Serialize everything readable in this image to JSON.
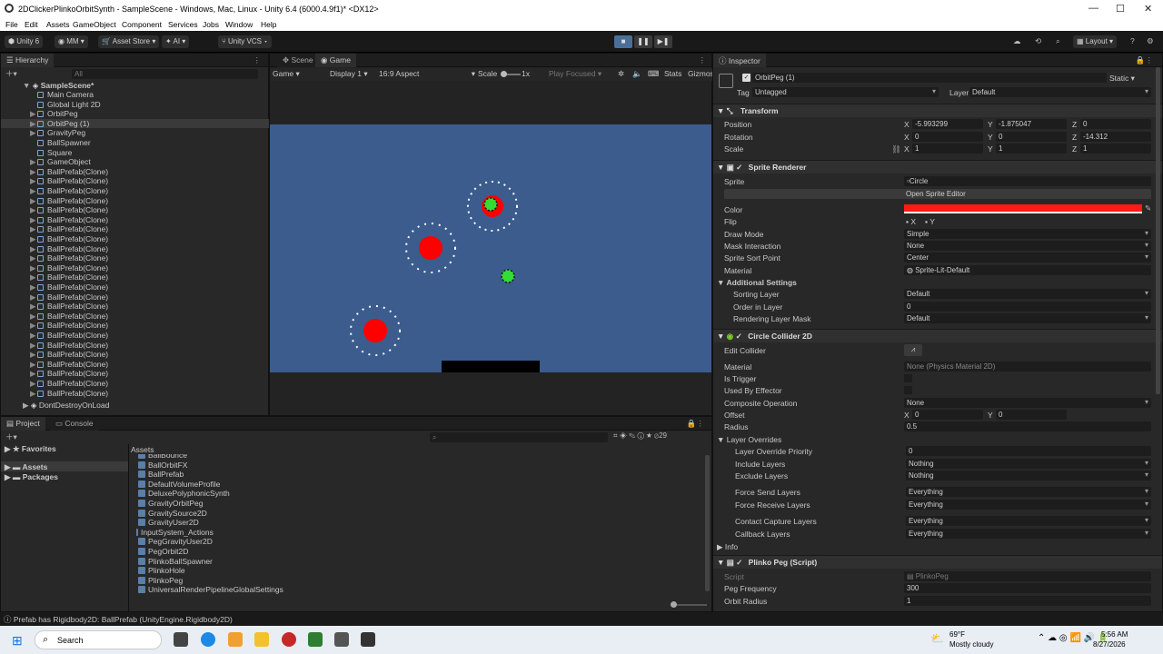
{
  "window": {
    "title": "2DClickerPlinkoOrbitSynth - SampleScene - Windows, Mac, Linux - Unity 6.4 (6000.4.9f1)* <DX12>"
  },
  "menu": [
    "File",
    "Edit",
    "Assets",
    "GameObject",
    "Component",
    "Services",
    "Jobs",
    "Window",
    "Help"
  ],
  "toolbar": {
    "account": "Unity 6",
    "user": "MM",
    "asset_store": "Asset Store",
    "ai": "AI",
    "vcs": "Unity VCS",
    "layout": "Layout"
  },
  "hierarchy": {
    "tab": "Hierarchy",
    "search_placeholder": "All",
    "scene": "SampleScene*",
    "items": [
      "Main Camera",
      "Global Light 2D",
      "OrbitPeg",
      "OrbitPeg (1)",
      "GravityPeg",
      "BallSpawner",
      "Square",
      "GameObject",
      "BallPrefab(Clone)",
      "BallPrefab(Clone)",
      "BallPrefab(Clone)",
      "BallPrefab(Clone)",
      "BallPrefab(Clone)",
      "BallPrefab(Clone)",
      "BallPrefab(Clone)",
      "BallPrefab(Clone)",
      "BallPrefab(Clone)",
      "BallPrefab(Clone)",
      "BallPrefab(Clone)",
      "BallPrefab(Clone)",
      "BallPrefab(Clone)",
      "BallPrefab(Clone)",
      "BallPrefab(Clone)",
      "BallPrefab(Clone)",
      "BallPrefab(Clone)",
      "BallPrefab(Clone)",
      "BallPrefab(Clone)",
      "BallPrefab(Clone)",
      "BallPrefab(Clone)",
      "BallPrefab(Clone)",
      "BallPrefab(Clone)",
      "BallPrefab(Clone)"
    ],
    "dontdestroy": "DontDestroyOnLoad"
  },
  "game_view": {
    "tabs": [
      "Scene",
      "Game"
    ],
    "game": "Game",
    "display": "Display 1",
    "aspect": "16:9 Aspect",
    "scale_label": "Scale",
    "scale_value": "1x",
    "play_focused": "Play Focused",
    "stats": "Stats",
    "gizmos": "Gizmos",
    "colors": {
      "bg": "#3b5c8c",
      "peg": "#ff0000",
      "ball": "#33dd33",
      "floor": "#000000"
    }
  },
  "inspector": {
    "tab": "Inspector",
    "object": "OrbitPeg (1)",
    "static": "Static",
    "tag_label": "Tag",
    "tag": "Untagged",
    "layer_label": "Layer",
    "layer": "Default",
    "transform": {
      "title": "Transform",
      "position": "Position",
      "rotation": "Rotation",
      "scale": "Scale",
      "px": "-5.993299",
      "py": "-1.875047",
      "pz": "0",
      "rx": "0",
      "ry": "0",
      "rz": "-14.312",
      "sx": "1",
      "sy": "1",
      "sz": "1",
      "x": "X",
      "y": "Y",
      "z": "Z"
    },
    "sprite_renderer": {
      "title": "Sprite Renderer",
      "sprite_label": "Sprite",
      "sprite": "Circle",
      "open_editor": "Open Sprite Editor",
      "color_label": "Color",
      "color": "#ff1a1a",
      "flip_label": "Flip",
      "flip_x": "X",
      "flip_y": "Y",
      "draw_mode_label": "Draw Mode",
      "draw_mode": "Simple",
      "mask_label": "Mask Interaction",
      "mask": "None",
      "sort_point_label": "Sprite Sort Point",
      "sort_point": "Center",
      "material_label": "Material",
      "material": "Sprite-Lit-Default",
      "additional": "Additional Settings",
      "sorting_layer_label": "Sorting Layer",
      "sorting_layer": "Default",
      "order_label": "Order in Layer",
      "order": "0",
      "rlm_label": "Rendering Layer Mask",
      "rlm": "Default"
    },
    "circle_collider": {
      "title": "Circle Collider 2D",
      "edit_collider": "Edit Collider",
      "material_label": "Material",
      "material": "None (Physics Material 2D)",
      "is_trigger": "Is Trigger",
      "used_by_effector": "Used By Effector",
      "composite_label": "Composite Operation",
      "composite": "None",
      "offset_label": "Offset",
      "offset_x": "0",
      "offset_y": "0",
      "radius_label": "Radius",
      "radius": "0.5",
      "layer_overrides": "Layer Overrides",
      "lop_label": "Layer Override Priority",
      "lop": "0",
      "include_label": "Include Layers",
      "include": "Nothing",
      "exclude_label": "Exclude Layers",
      "exclude": "Nothing",
      "force_send_label": "Force Send Layers",
      "force_send": "Everything",
      "force_receive_label": "Force Receive Layers",
      "force_receive": "Everything",
      "contact_label": "Contact Capture Layers",
      "contact": "Everything",
      "callback_label": "Callback Layers",
      "callback": "Everything",
      "info": "Info"
    },
    "plinko_peg": {
      "title": "Plinko Peg (Script)",
      "script_label": "Script",
      "script": "PlinkoPeg",
      "freq_label": "Peg Frequency",
      "freq": "300",
      "orbit_label": "Orbit Radius",
      "orbit": "1"
    }
  },
  "project": {
    "tabs": [
      "Project",
      "Console"
    ],
    "favorites": "Favorites",
    "assets": "Assets",
    "packages": "Packages",
    "breadcrumb": "Assets",
    "count": "29",
    "files": [
      "BallBounce",
      "BallOrbitFX",
      "BallPrefab",
      "DefaultVolumeProfile",
      "DeluxePolyphonicSynth",
      "GravityOrbitPeg",
      "GravitySource2D",
      "GravityUser2D",
      "InputSystem_Actions",
      "PegGravityUser2D",
      "PegOrbit2D",
      "PlinkoBallSpawner",
      "PlinkoHole",
      "PlinkoPeg",
      "UniversalRenderPipelineGlobalSettings"
    ]
  },
  "status": {
    "message": "Prefab has Rigidbody2D: BallPrefab (UnityEngine.Rigidbody2D)"
  },
  "taskbar": {
    "search": "Search",
    "weather_temp": "69°F",
    "weather": "Mostly cloudy",
    "time": "5:56 AM",
    "date": "8/27/2026"
  }
}
